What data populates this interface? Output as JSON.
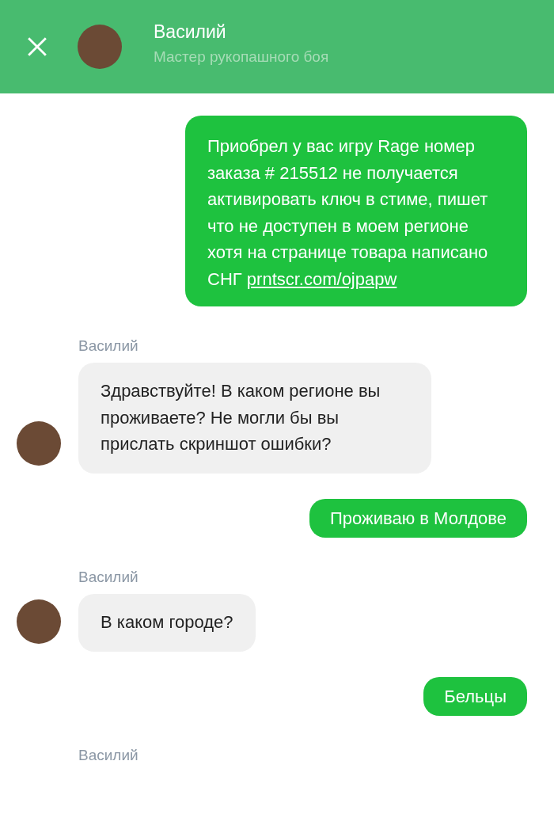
{
  "header": {
    "contact_name": "Василий",
    "contact_status": "Мастер рукопашного боя"
  },
  "messages": [
    {
      "kind": "outgoing",
      "text": "Приобрел у вас игру Rage номер заказа # 215512 не получается активировать ключ в стиме, пишет что не доступен в моем регионе хотя на странице товара написано СНГ",
      "link": "prntscr.com/ojpapw"
    },
    {
      "kind": "incoming",
      "sender": "Василий",
      "text": "Здравствуйте! В каком регионе вы проживаете? Не могли бы вы прислать скриншот ошибки?"
    },
    {
      "kind": "outgoing",
      "text": "Проживаю в Молдове"
    },
    {
      "kind": "incoming",
      "sender": "Василий",
      "text": "В каком городе?"
    },
    {
      "kind": "outgoing",
      "text": "Бельцы"
    },
    {
      "kind": "sender_only",
      "sender": "Василий"
    }
  ]
}
